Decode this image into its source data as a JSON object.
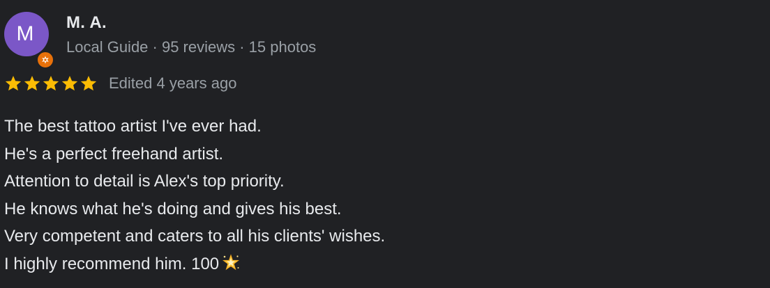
{
  "reviewer": {
    "avatar_letter": "M",
    "name": "M. A.",
    "meta": "Local Guide · 95 reviews · 15 photos"
  },
  "rating": {
    "stars": 5,
    "max_stars": 5,
    "date": "Edited 4 years ago"
  },
  "review": {
    "lines": [
      "The best tattoo artist I've ever had.",
      "He's a perfect freehand artist.",
      "Attention to detail is Alex's top priority.",
      "He knows what he's doing and gives his best.",
      "Very competent and caters to all his clients' wishes.",
      "I highly recommend him. 100"
    ],
    "trailing_emoji": "glowing-star-icon"
  },
  "colors": {
    "background": "#202124",
    "avatar": "#7b57c7",
    "badge": "#e8710a",
    "star": "#fbbc04",
    "text": "#e8eaed",
    "muted": "#9aa0a6"
  }
}
